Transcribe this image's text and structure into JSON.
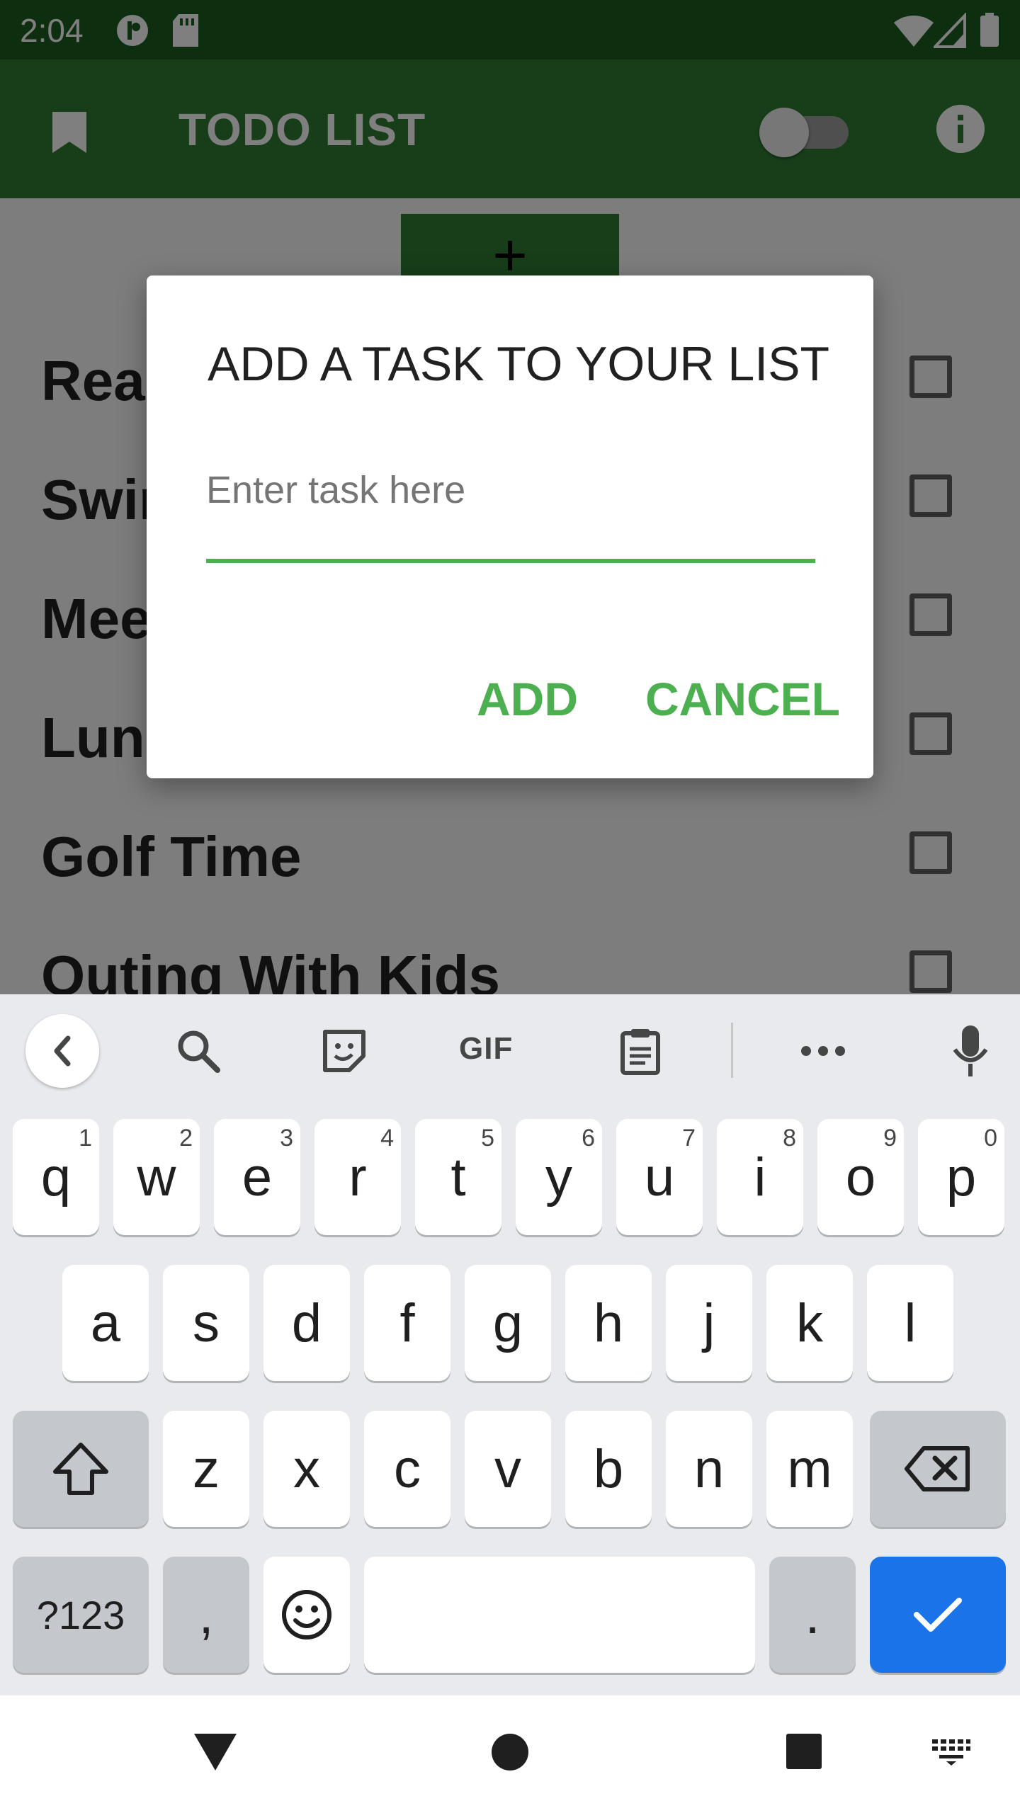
{
  "status_bar": {
    "time": "2:04"
  },
  "app_bar": {
    "title": "TODO LIST",
    "add_button_label": "+"
  },
  "tasks": [
    {
      "label": "Read Books"
    },
    {
      "label": "Swimming"
    },
    {
      "label": "Meeting"
    },
    {
      "label": "Lunch"
    },
    {
      "label": "Golf Time"
    },
    {
      "label": "Outing With Kids"
    }
  ],
  "dialog": {
    "title": "ADD A TASK TO YOUR LIST",
    "input_placeholder": "Enter task here",
    "input_value": "",
    "add_label": "ADD",
    "cancel_label": "CANCEL"
  },
  "keyboard": {
    "toolbar": {
      "gif_label": "GIF",
      "icons": [
        "back-icon",
        "search-icon",
        "sticker-icon",
        "gif-icon",
        "clipboard-icon",
        "more-icon",
        "mic-icon"
      ]
    },
    "row1": [
      {
        "key": "q",
        "hint": "1"
      },
      {
        "key": "w",
        "hint": "2"
      },
      {
        "key": "e",
        "hint": "3"
      },
      {
        "key": "r",
        "hint": "4"
      },
      {
        "key": "t",
        "hint": "5"
      },
      {
        "key": "y",
        "hint": "6"
      },
      {
        "key": "u",
        "hint": "7"
      },
      {
        "key": "i",
        "hint": "8"
      },
      {
        "key": "o",
        "hint": "9"
      },
      {
        "key": "p",
        "hint": "0"
      }
    ],
    "row2": [
      "a",
      "s",
      "d",
      "f",
      "g",
      "h",
      "j",
      "k",
      "l"
    ],
    "row3": [
      "z",
      "x",
      "c",
      "v",
      "b",
      "n",
      "m"
    ],
    "row4": {
      "symbols_label": "?123",
      "comma_label": ",",
      "period_label": "."
    }
  },
  "colors": {
    "status_bar": "#1b5e20",
    "app_bar": "#2e7d32",
    "accent": "#4caf50",
    "keyboard_action": "#1a73e8"
  }
}
